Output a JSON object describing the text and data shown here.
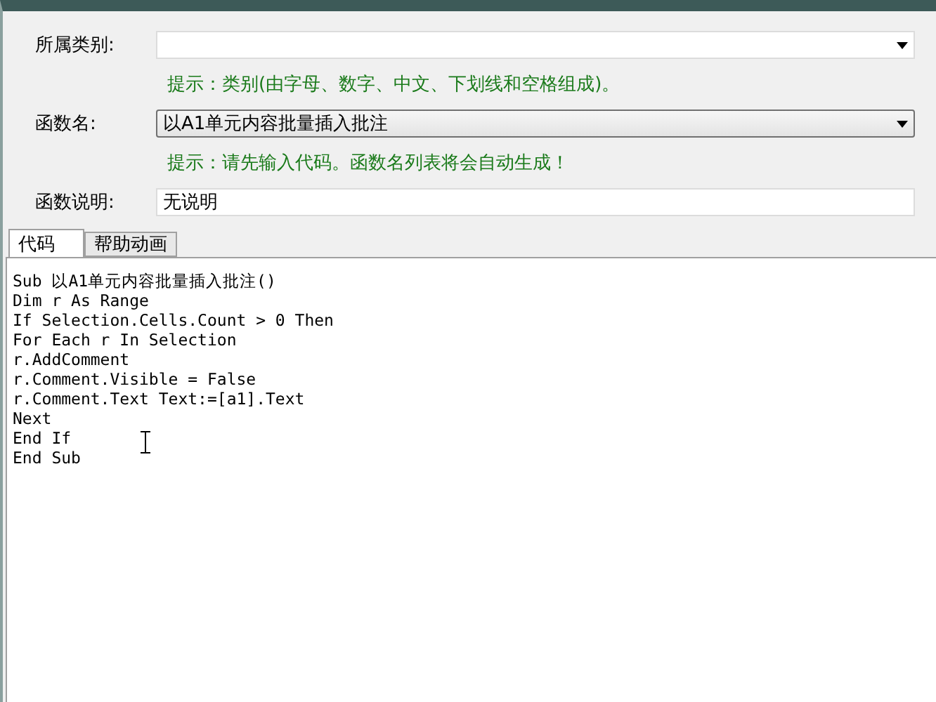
{
  "form": {
    "category": {
      "label": "所属类别:"
    },
    "category_hint": "提示：类别(由字母、数字、中文、下划线和空格组成)。",
    "function_name": {
      "label": "函数名:",
      "value": "以A1单元内容批量插入批注"
    },
    "function_hint": "提示：请先输入代码。函数名列表将会自动生成！",
    "description": {
      "label": "函数说明:",
      "value": "无说明"
    }
  },
  "tabs": [
    {
      "label": "代码",
      "selected": true
    },
    {
      "label": "帮助动画",
      "selected": false
    }
  ],
  "code_lines": [
    "Sub 以A1单元内容批量插入批注()",
    "Dim r As Range",
    "If Selection.Cells.Count > 0 Then",
    "For Each r In Selection",
    "r.AddComment",
    "r.Comment.Visible = False",
    "r.Comment.Text Text:=[a1].Text",
    "Next",
    "End If",
    "End Sub"
  ]
}
